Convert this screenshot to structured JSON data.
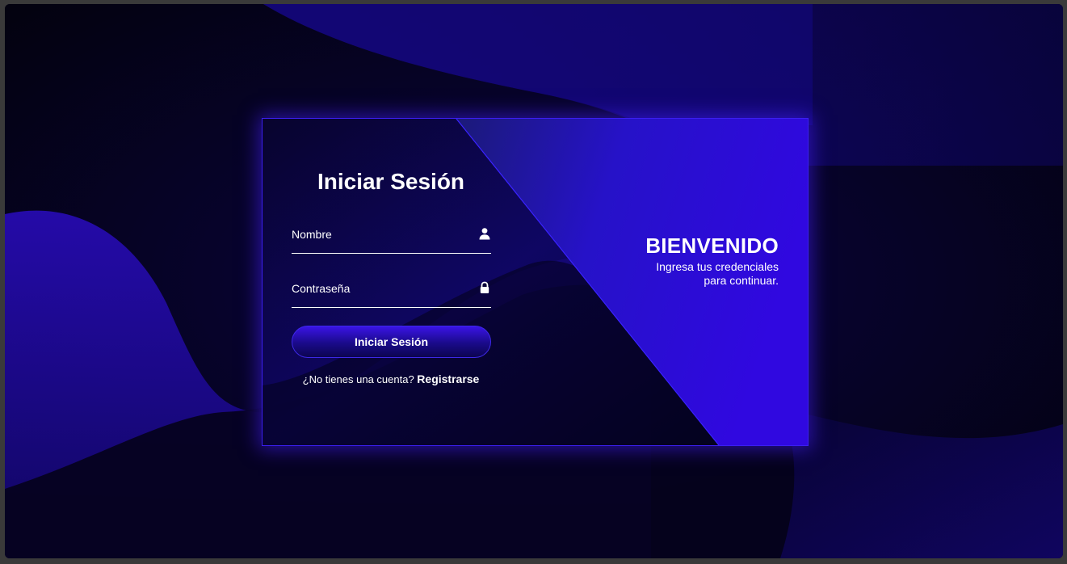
{
  "login_form": {
    "title": "Iniciar Sesión",
    "name_field": {
      "label": "Nombre",
      "value": "",
      "icon": "user-icon"
    },
    "password_field": {
      "label": "Contraseña",
      "value": "",
      "icon": "lock-icon"
    },
    "submit_label": "Iniciar Sesión",
    "register_prompt": "¿No tienes una cuenta?",
    "register_link": "Registrarse"
  },
  "welcome_panel": {
    "heading": "BIENVENIDO",
    "subtitle": "Ingresa tus credenciales para continuar."
  },
  "colors": {
    "accent": "#3b1ff0",
    "background": "#04021a",
    "panel": "#2a0ad8",
    "text": "#ffffff"
  }
}
